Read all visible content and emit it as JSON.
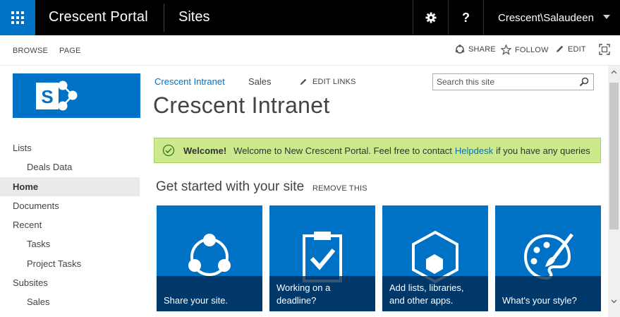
{
  "suite": {
    "brand": "Crescent Portal",
    "sites_link": "Sites",
    "help_label": "?",
    "user": "Crescent\\Salaudeen",
    "accent": "#0072c6"
  },
  "ribbon": {
    "tabs": [
      "BROWSE",
      "PAGE"
    ],
    "actions": {
      "share": "SHARE",
      "follow": "FOLLOW",
      "edit": "EDIT"
    }
  },
  "quicklaunch": [
    {
      "label": "Lists"
    },
    {
      "label": "Deals Data"
    },
    {
      "label": "Home",
      "selected": true
    },
    {
      "label": "Documents"
    },
    {
      "label": "Recent"
    },
    {
      "label": "Tasks"
    },
    {
      "label": "Project Tasks"
    },
    {
      "label": "Subsites"
    },
    {
      "label": "Sales"
    }
  ],
  "topnav": {
    "site_link": "Crescent Intranet",
    "sales_link": "Sales",
    "edit_links": "EDIT LINKS"
  },
  "search": {
    "placeholder": "Search this site",
    "value": ""
  },
  "page_title": "Crescent Intranet",
  "welcome": {
    "bold": "Welcome!",
    "text_before": "Welcome to New Crescent Portal. Feel free to contact",
    "link": "Helpdesk",
    "text_after": "if you have any queries",
    "bg_color": "#cce98e"
  },
  "getting_started": {
    "title": "Get started with your site",
    "remove": "REMOVE THIS",
    "tiles": [
      {
        "label": "Share your site.",
        "icon": "share-icon"
      },
      {
        "label": "Working on a deadline?",
        "icon": "clipboard-check-icon"
      },
      {
        "label": "Add lists, libraries, and other apps.",
        "icon": "hexagon-app-icon"
      },
      {
        "label": "What's your style?",
        "icon": "palette-icon"
      }
    ]
  }
}
